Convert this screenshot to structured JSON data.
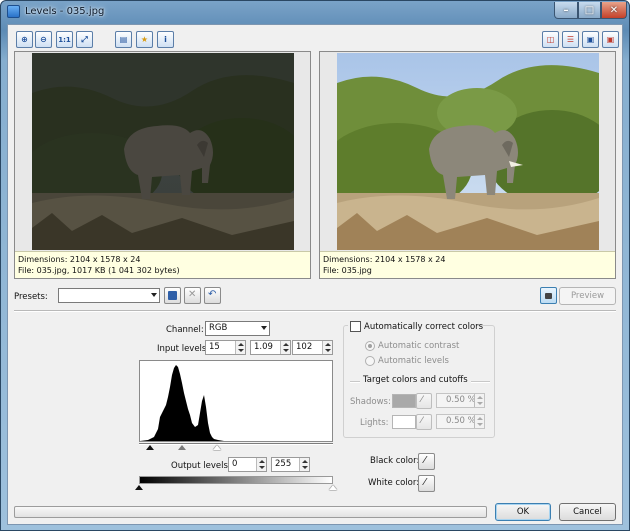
{
  "window": {
    "title": "Levels - 035.jpg"
  },
  "toolbar": {
    "zoom_actual_label": "1:1"
  },
  "preview": {
    "left": {
      "dimensions": "Dimensions: 2104 x 1578 x 24",
      "file": "File: 035.jpg, 1017 KB (1 041 302 bytes)"
    },
    "right": {
      "dimensions": "Dimensions: 2104 x 1578 x 24",
      "file": "File: 035.jpg"
    }
  },
  "presets": {
    "label": "Presets:",
    "value": ""
  },
  "preview_button": "Preview",
  "channel": {
    "label": "Channel:",
    "value": "RGB"
  },
  "input_levels": {
    "label": "Input levels:",
    "black": "15",
    "gamma": "1.09",
    "white": "102",
    "black_point": 15,
    "gamma_point": 1.09,
    "white_point": 102,
    "max": 255
  },
  "output_levels": {
    "label": "Output levels:",
    "low": "0",
    "high": "255",
    "low_point": 0,
    "high_point": 255,
    "max": 255
  },
  "auto_correct": {
    "label": "Automatically correct colors",
    "checked": false,
    "contrast_label": "Automatic contrast",
    "levels_label": "Automatic levels",
    "target_title": "Target colors and cutoffs",
    "shadows_label": "Shadows:",
    "shadows_value": "0.50 %",
    "lights_label": "Lights:",
    "lights_value": "0.50 %"
  },
  "black_color_label": "Black color:",
  "white_color_label": "White color:",
  "buttons": {
    "ok": "OK",
    "cancel": "Cancel"
  },
  "colors": {
    "titlebar": "#5d8bb5",
    "info_background": "#ffffe1",
    "default_button": "#3c7fb1"
  }
}
